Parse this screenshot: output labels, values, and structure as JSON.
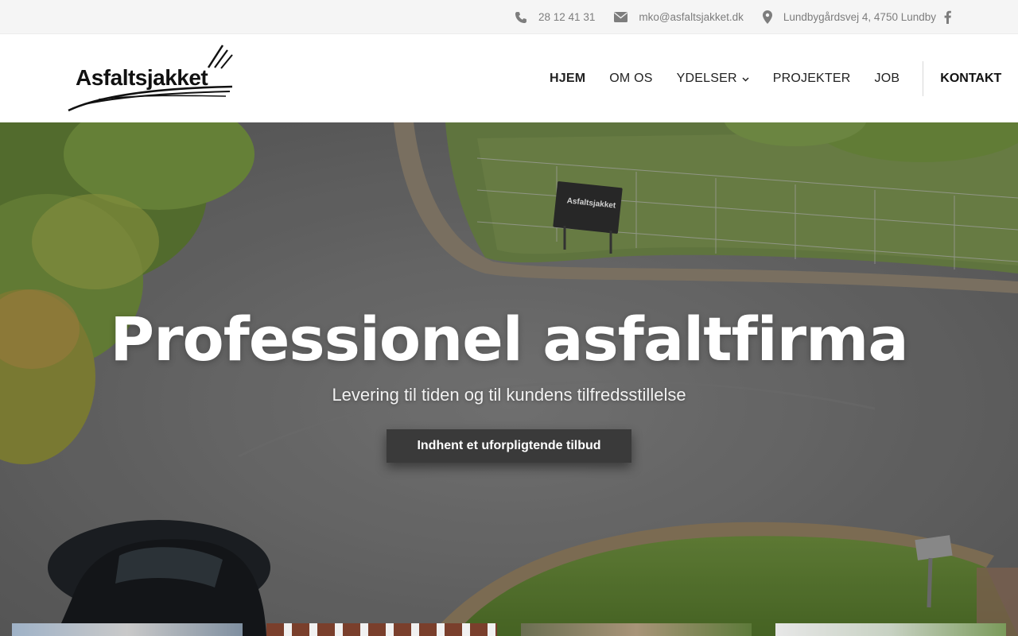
{
  "topbar": {
    "phone": "28 12 41 31",
    "email": "mko@asfaltsjakket.dk",
    "address": "Lundbygårdsvej 4, 4750 Lundby",
    "icons": [
      "phone-icon",
      "envelope-icon",
      "map-pin-icon",
      "facebook-icon"
    ]
  },
  "header": {
    "logo_text": "Asfaltsjakket",
    "nav": [
      {
        "label": "HJEM",
        "active": true
      },
      {
        "label": "OM OS"
      },
      {
        "label": "YDELSER",
        "has_dropdown": true
      },
      {
        "label": "PROJEKTER"
      },
      {
        "label": "JOB"
      }
    ],
    "contact_label": "KONTAKT"
  },
  "hero": {
    "title": "Professionel asfaltfirma",
    "subtitle": "Levering til tiden og til kundens tilfredsstillelse",
    "cta_label": "Indhent et uforpligtende tilbud",
    "sign_text": "Asfaltsjakket"
  },
  "colors": {
    "topbar_bg": "#f5f5f5",
    "topbar_text": "#7d7d7d",
    "cta_bg": "#3a3a3a"
  }
}
